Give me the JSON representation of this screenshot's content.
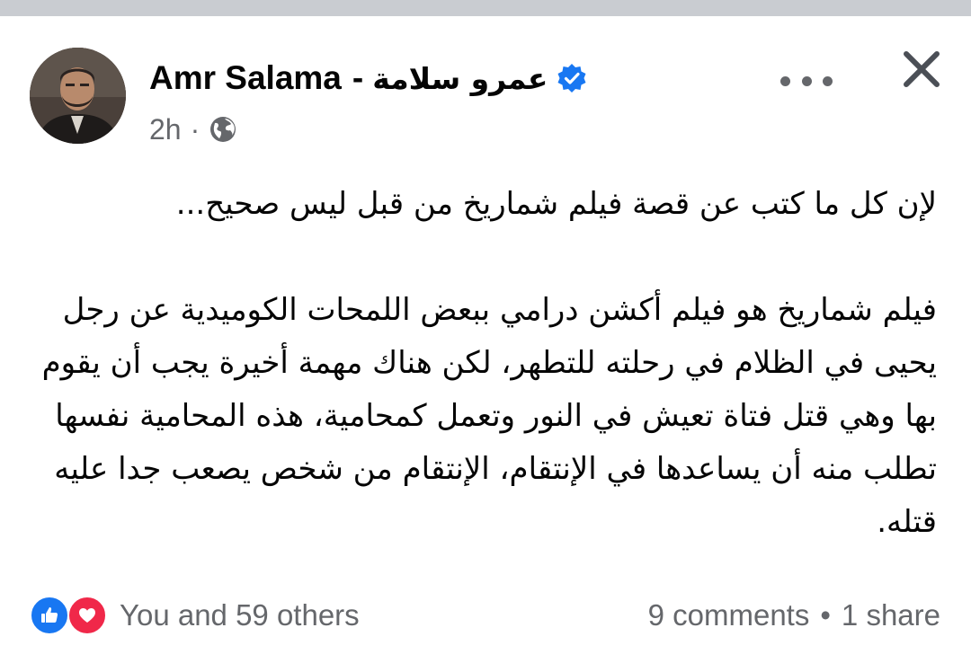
{
  "post": {
    "author_en": "Amr Salama",
    "separator": "-",
    "author_ar": "عمرو سلامة",
    "time": "2h",
    "dot": "·",
    "audience_icon": "globe-icon",
    "verified_icon": "verified-badge-icon",
    "more_icon": "more-options-icon",
    "close_icon": "close-icon",
    "paragraphs": [
      "لإن كل ما كتب عن قصة فيلم شماريخ من قبل ليس صحيح...",
      "فيلم شماريخ هو فيلم أكشن درامي ببعض اللمحات الكوميدية عن رجل يحيى في الظلام في رحلته للتطهر، لكن هناك مهمة أخيرة يجب أن يقوم بها وهي قتل فتاة تعيش في النور وتعمل كمحامية، هذه المحامية نفسها تطلب منه أن يساعدها في الإنتقام، الإنتقام من شخص يصعب جدا عليه قتله."
    ]
  },
  "footer": {
    "reactions_text": "You and 59 others",
    "reaction_icons": [
      "like-icon",
      "love-icon"
    ],
    "comments": "9 comments",
    "dot": "•",
    "shares": "1 share"
  },
  "colors": {
    "verified": "#1877f2",
    "like": "#1877f2",
    "love": "#f02849",
    "secondary_text": "#65676b",
    "top_bar": "#c9ccd1"
  }
}
